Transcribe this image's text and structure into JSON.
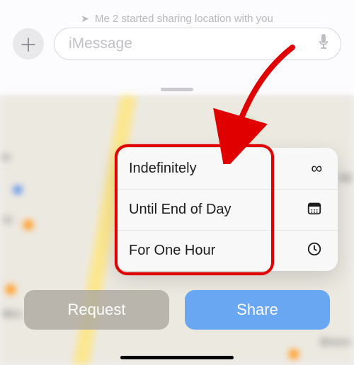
{
  "status_line": "Me 2 started sharing location with you",
  "compose": {
    "placeholder": "iMessage"
  },
  "menu": {
    "items": [
      {
        "label": "Indefinitely",
        "icon": "infinity-icon"
      },
      {
        "label": "Until End of Day",
        "icon": "calendar-icon"
      },
      {
        "label": "For One Hour",
        "icon": "clock-icon"
      }
    ]
  },
  "buttons": {
    "request": "Request",
    "share": "Share"
  },
  "map_labels": {
    "left1": "ar",
    "left2": "Vi",
    "left3": "McL",
    "right1": "SE",
    "right2": "Bistro"
  }
}
